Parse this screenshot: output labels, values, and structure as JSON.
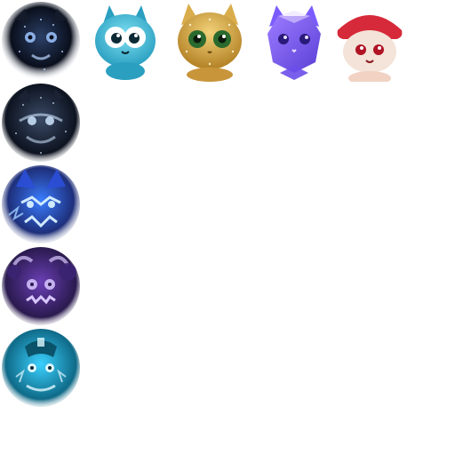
{
  "sprites": [
    {
      "name": "dark-starry-beast-avatar",
      "palette": [
        "#0a0f1c",
        "#2b3f66",
        "#b9d6ff"
      ]
    },
    {
      "name": "cyan-cat-avatar",
      "palette": [
        "#2a9fc0",
        "#7fe0f2",
        "#ffffff"
      ]
    },
    {
      "name": "golden-cat-avatar",
      "palette": [
        "#b7862a",
        "#f2d27a",
        "#2b6a2e"
      ]
    },
    {
      "name": "purple-crystal-cat-avatar",
      "palette": [
        "#5a3fd6",
        "#9b7bff",
        "#e8dcff"
      ]
    },
    {
      "name": "red-hat-cat-avatar",
      "palette": [
        "#d62a3a",
        "#f4e3d8",
        "#b01424"
      ]
    },
    {
      "name": "dark-galaxy-dragon-avatar",
      "palette": [
        "#0d1320",
        "#3a4a66",
        "#cfe6ff"
      ]
    },
    {
      "name": "blue-lightning-dragon-avatar",
      "palette": [
        "#1e2f7a",
        "#3a7cff",
        "#cfe9ff"
      ]
    },
    {
      "name": "purple-demon-avatar",
      "palette": [
        "#2a1a4e",
        "#6a3fb5",
        "#d8c7ff"
      ]
    },
    {
      "name": "ice-warrior-avatar",
      "palette": [
        "#0f6a88",
        "#3ad1ff",
        "#dff8ff"
      ]
    }
  ]
}
